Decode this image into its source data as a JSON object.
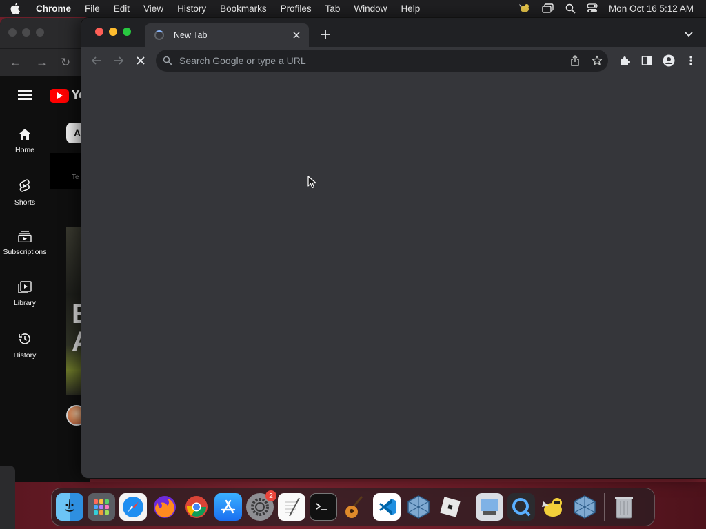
{
  "menubar": {
    "app_name": "Chrome",
    "menus": [
      "File",
      "Edit",
      "View",
      "History",
      "Bookmarks",
      "Profiles",
      "Tab",
      "Window",
      "Help"
    ],
    "clock": "Mon Oct 16  5:12 AM"
  },
  "youtube_window": {
    "logo_text": "Yo",
    "nav": [
      {
        "label": "Home",
        "icon": "home-icon"
      },
      {
        "label": "Shorts",
        "icon": "shorts-icon"
      },
      {
        "label": "Subscriptions",
        "icon": "subscriptions-icon"
      },
      {
        "label": "Library",
        "icon": "library-icon"
      },
      {
        "label": "History",
        "icon": "history-icon"
      }
    ],
    "chip": "A",
    "dark_block_text": "Te",
    "thumbnail_text_1": "E",
    "thumbnail_text_2": "A"
  },
  "chrome": {
    "tab": {
      "title": "New Tab",
      "loading": true
    },
    "omnibox": {
      "placeholder": "Search Google or type a URL",
      "value": ""
    }
  },
  "dock": {
    "apps": [
      "Finder",
      "Launchpad",
      "Safari",
      "Firefox",
      "Google Chrome",
      "App Store",
      "System Settings",
      "TextEdit",
      "Terminal",
      "GarageBand",
      "Visual Studio Code",
      "VirtualBox",
      "Roblox",
      "Preview",
      "QuickTime Player",
      "Cyberduck",
      "VirtualBox VM",
      "Trash"
    ],
    "system_settings_badge": "2"
  },
  "colors": {
    "chrome_bg": "#35363a",
    "tabstrip_bg": "#202124",
    "close": "#ff5f57",
    "minimize": "#febc2e",
    "maximize": "#28c840"
  }
}
